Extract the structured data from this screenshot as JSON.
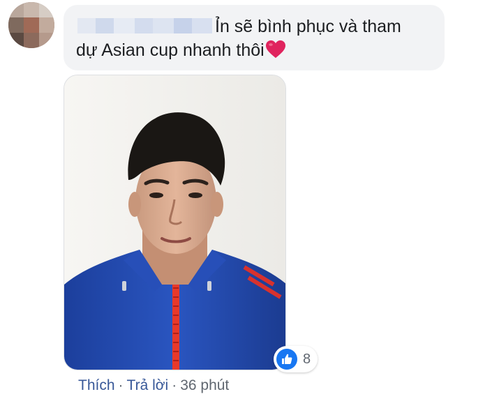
{
  "comment": {
    "text_line1": "Ỉn sẽ bình phục và tham",
    "text_line2": "dự Asian cup nhanh thôi",
    "emoji": "red-heart"
  },
  "reactions": {
    "icon": "like-icon",
    "count": "8"
  },
  "actions": {
    "like_label": "Thích",
    "separator": "·",
    "reply_label": "Trả lời",
    "timestamp": "36 phút"
  },
  "colors": {
    "bubble_bg": "#f2f3f5",
    "text": "#1c1e21",
    "link": "#385898",
    "muted": "#606770",
    "like_blue": "#1877f2",
    "heart_red": "#e0245e"
  }
}
